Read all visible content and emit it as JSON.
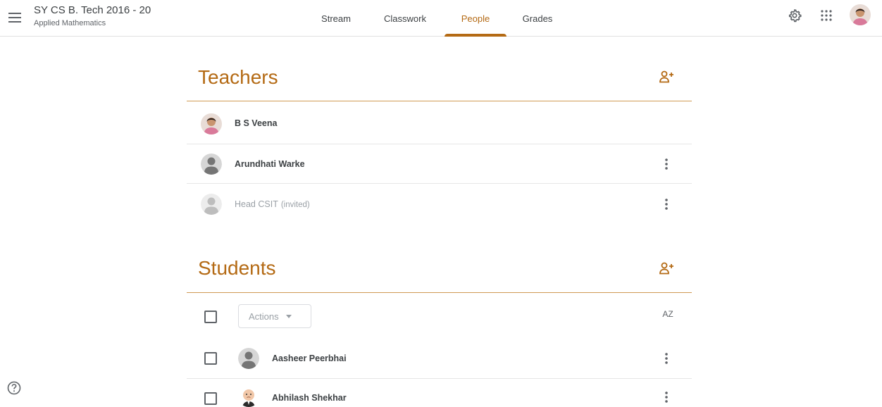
{
  "header": {
    "class_title": "SY CS B. Tech 2016 - 20",
    "class_subtitle": "Applied Mathematics",
    "tabs": [
      {
        "label": "Stream"
      },
      {
        "label": "Classwork"
      },
      {
        "label": "People",
        "active": true
      },
      {
        "label": "Grades"
      }
    ]
  },
  "teachers": {
    "title": "Teachers",
    "people": [
      {
        "name": "B S Veena",
        "avatar": "photo",
        "has_menu": false
      },
      {
        "name": "Arundhati Warke",
        "avatar": "default",
        "has_menu": true
      },
      {
        "name": "Head CSIT",
        "status": "(invited)",
        "avatar": "default-light",
        "has_menu": true
      }
    ]
  },
  "students": {
    "title": "Students",
    "actions_label": "Actions",
    "sort_label": "AZ",
    "people": [
      {
        "name": "Aasheer Peerbhai",
        "avatar": "default",
        "has_menu": true
      },
      {
        "name": "Abhilash Shekhar",
        "avatar": "photo",
        "has_menu": true
      }
    ]
  },
  "colors": {
    "accent": "#b46a14",
    "rule": "#d09a52",
    "text": "#3c4043",
    "muted": "#9aa0a6"
  },
  "icons": {
    "menu": "hamburger-menu-icon",
    "settings": "gear-icon",
    "apps": "apps-grid-icon",
    "add_person": "person-add-icon",
    "more": "more-vert-icon",
    "help": "help-circle-icon",
    "sort": "sort-az-icon"
  }
}
